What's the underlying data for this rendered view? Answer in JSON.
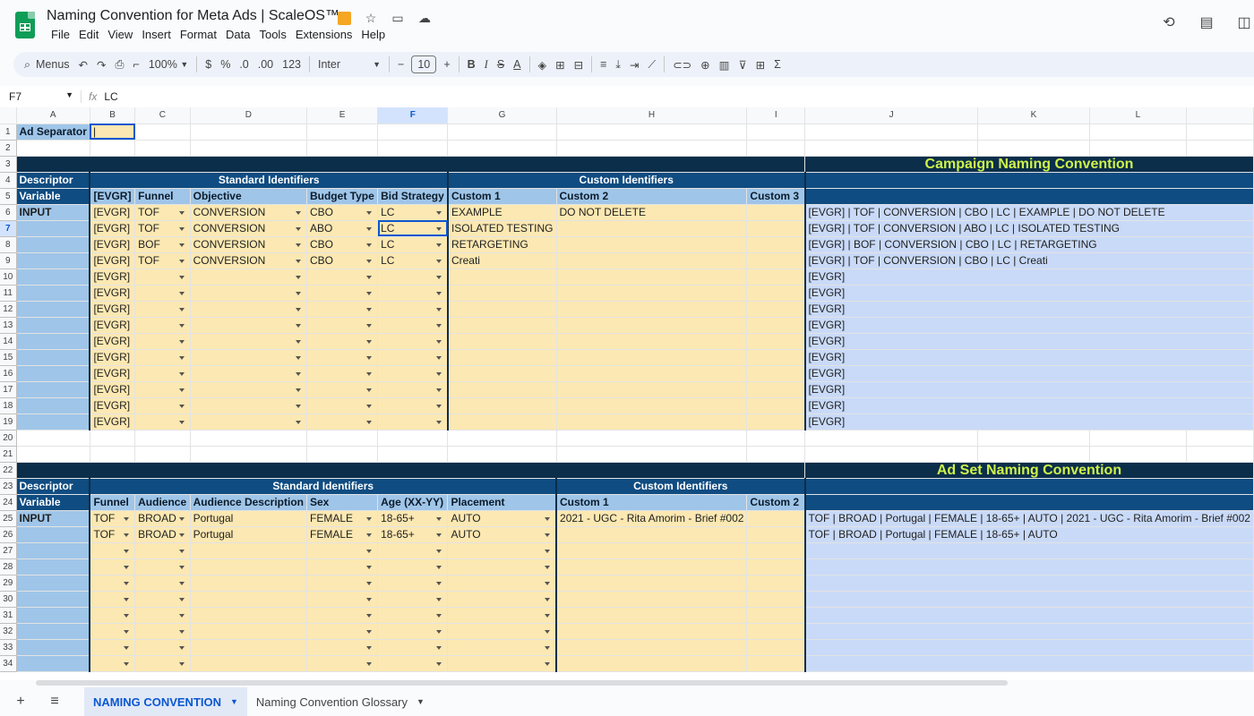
{
  "doc": {
    "title": "Naming Convention for Meta Ads | ScaleOS™",
    "menu": [
      "File",
      "Edit",
      "View",
      "Insert",
      "Format",
      "Data",
      "Tools",
      "Extensions",
      "Help"
    ]
  },
  "toolbar": {
    "search_label": "Menus",
    "zoom": "100%",
    "currency": "$",
    "percent": "%",
    "dec_less": ".0",
    "dec_more": ".00",
    "num_format": "123",
    "font": "Inter",
    "font_size": "10"
  },
  "formula": {
    "cell_ref": "F7",
    "fx": "fx",
    "value": "LC"
  },
  "columns": [
    "A",
    "B",
    "C",
    "D",
    "E",
    "F",
    "G",
    "H",
    "I",
    "J",
    "K",
    "L"
  ],
  "rows": {
    "r1": {
      "a": "Ad Separator",
      "b": "|"
    },
    "campaign_title": "Campaign Naming Convention",
    "descriptor": "Descriptor",
    "standard_identifiers": "Standard Identifiers",
    "custom_identifiers": "Custom Identifiers",
    "variable": "Variable",
    "input": "INPUT",
    "campaign_headers": [
      "[EVGR]",
      "Funnel",
      "Objective",
      "Budget Type",
      "Bid Strategy",
      "Custom 1",
      "Custom 2",
      "Custom 3"
    ],
    "campaign_data": [
      [
        "[EVGR]",
        "TOF",
        "CONVERSION",
        "CBO",
        "LC",
        "EXAMPLE",
        "DO NOT DELETE",
        "",
        "[EVGR] | TOF | CONVERSION | CBO | LC | EXAMPLE | DO NOT DELETE"
      ],
      [
        "[EVGR]",
        "TOF",
        "CONVERSION",
        "ABO",
        "LC",
        "ISOLATED TESTING",
        "",
        "",
        "[EVGR] | TOF | CONVERSION | ABO | LC | ISOLATED TESTING"
      ],
      [
        "[EVGR]",
        "BOF",
        "CONVERSION",
        "CBO",
        "LC",
        "RETARGETING",
        "",
        "",
        "[EVGR] | BOF | CONVERSION | CBO | LC | RETARGETING"
      ],
      [
        "[EVGR]",
        "TOF",
        "CONVERSION",
        "CBO",
        "LC",
        "Creati",
        "",
        "",
        "[EVGR] | TOF | CONVERSION | CBO | LC | Creati"
      ]
    ],
    "evgr": "[EVGR]",
    "adset_title": "Ad Set Naming Convention",
    "adset_headers": [
      "Funnel",
      "Audience",
      "Audience Description",
      "Sex",
      "Age (XX-YY)",
      "Placement",
      "Custom 1",
      "Custom 2"
    ],
    "adset_data": [
      [
        "TOF",
        "BROAD",
        "Portugal",
        "FEMALE",
        "18-65+",
        "AUTO",
        "2021 - UGC - Rita Amorim - Brief #002",
        "",
        "TOF | BROAD | Portugal | FEMALE | 18-65+ | AUTO | 2021 - UGC - Rita Amorim - Brief #002"
      ],
      [
        "TOF",
        "BROAD",
        "Portugal",
        "FEMALE",
        "18-65+",
        "AUTO",
        "",
        "",
        "TOF | BROAD | Portugal | FEMALE | 18-65+ | AUTO"
      ]
    ]
  },
  "tabs": [
    {
      "label": "NAMING CONVENTION",
      "active": true
    },
    {
      "label": "Naming Convention Glossary",
      "active": false
    }
  ]
}
